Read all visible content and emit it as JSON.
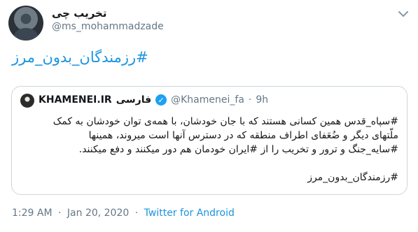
{
  "author": {
    "name": "تخریب چی",
    "handle": "@ms_mohammadzade"
  },
  "tweet": {
    "hashtag_text": "#رزمندگان_بدون_مرز"
  },
  "quoted": {
    "name": "KHAMENEI.IR",
    "name_suffix": "فارسی",
    "handle": "@Khamenei_fa",
    "dot": "·",
    "time": "9h",
    "body_lines": [
      "#سپاه_قدس همین کسانی هستند که با جان خودشان، با همه‌ی توان خودشان به کمک",
      "ملّتهای دیگر و ضُعَفای اطراف منطقه که در دسترس آنها است میروند، همینها",
      "#سایه_جنگ و ترور و تخریب را از #ایران خودمان هم دور میکنند و دفع میکنند."
    ],
    "body_hashtag": "#رزمندگان_بدون_مرز"
  },
  "footer": {
    "time": "1:29 AM",
    "sep": "·",
    "date": "Jan 20, 2020",
    "source": "Twitter for Android"
  },
  "icons": {
    "verified": "verified-badge-icon",
    "more": "chevron-down-icon"
  },
  "colors": {
    "link": "#1b95e0",
    "muted": "#657786",
    "border": "#ccd6dd"
  }
}
